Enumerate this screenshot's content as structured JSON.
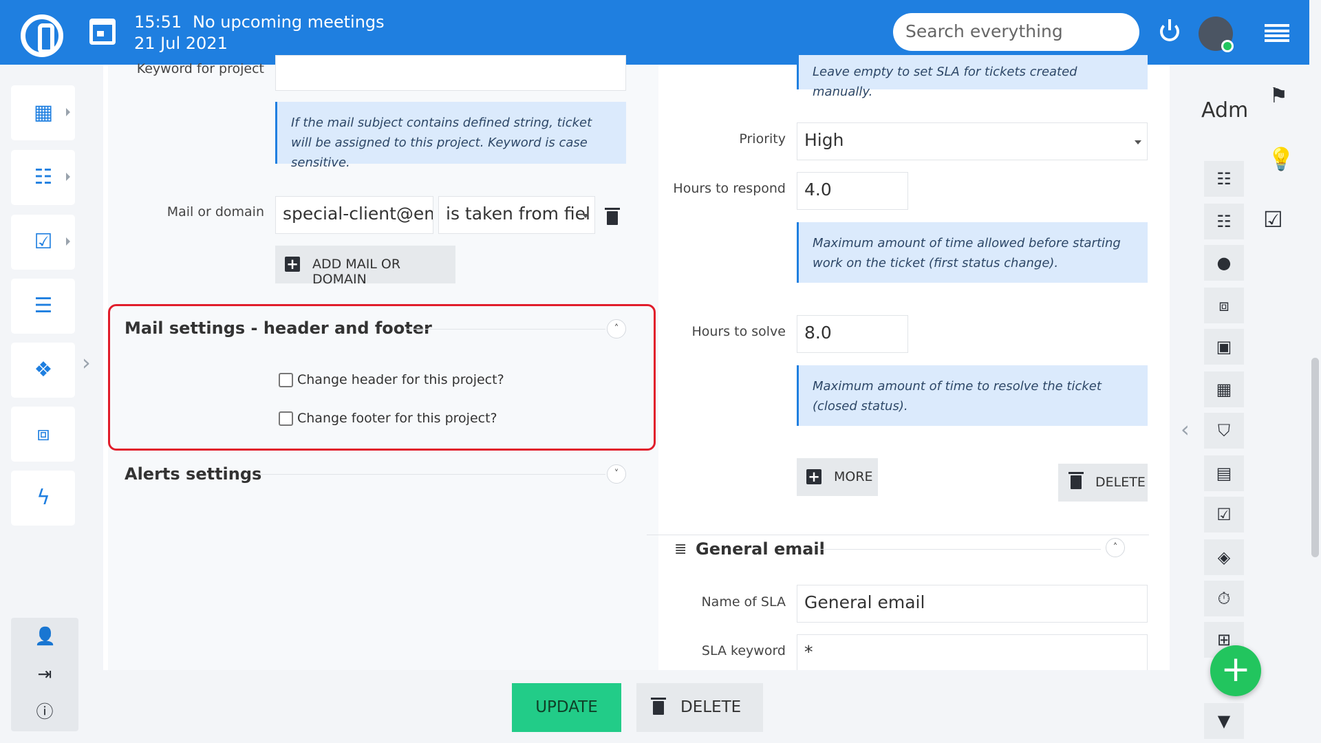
{
  "header": {
    "time": "15:51",
    "meetings": "No upcoming meetings",
    "date": "21 Jul 2021",
    "search_placeholder": "Search everything"
  },
  "left_form": {
    "keyword_label": "Keyword for project",
    "keyword_note": "If the mail subject contains defined string, ticket will be assigned to this project. Keyword is case sensitive.",
    "mail_label": "Mail or domain",
    "mail_value": "special-client@ema",
    "mail_select": "is taken from fiel",
    "add_mail_button": "ADD MAIL OR DOMAIN",
    "mail_settings_title": "Mail settings - header and footer",
    "change_header_label": "Change header for this project?",
    "change_footer_label": "Change footer for this project?",
    "alerts_title": "Alerts settings"
  },
  "right_form": {
    "top_note": "Leave empty to set SLA for tickets created manually.",
    "priority_label": "Priority",
    "priority_value": "High",
    "hours_respond_label": "Hours to respond",
    "hours_respond_value": "4.0",
    "respond_note": "Maximum amount of time allowed before starting work on the ticket (first status change).",
    "hours_solve_label": "Hours to solve",
    "hours_solve_value": "8.0",
    "solve_note": "Maximum amount of time to resolve the ticket (closed status).",
    "more_button": "MORE",
    "delete_button": "DELETE",
    "general_email_title": "General email",
    "sla_name_label": "Name of SLA",
    "sla_name_value": "General email",
    "sla_keyword_label": "SLA keyword",
    "sla_keyword_value": "*"
  },
  "footer": {
    "update_button": "UPDATE",
    "delete_button": "DELETE"
  },
  "right_sidebar": {
    "title": "Adm"
  },
  "colors": {
    "topbar": "#1f7fe0",
    "accent_green": "#22cc88",
    "highlight_red": "#e11d2b",
    "note_bg": "#dbeafc"
  }
}
